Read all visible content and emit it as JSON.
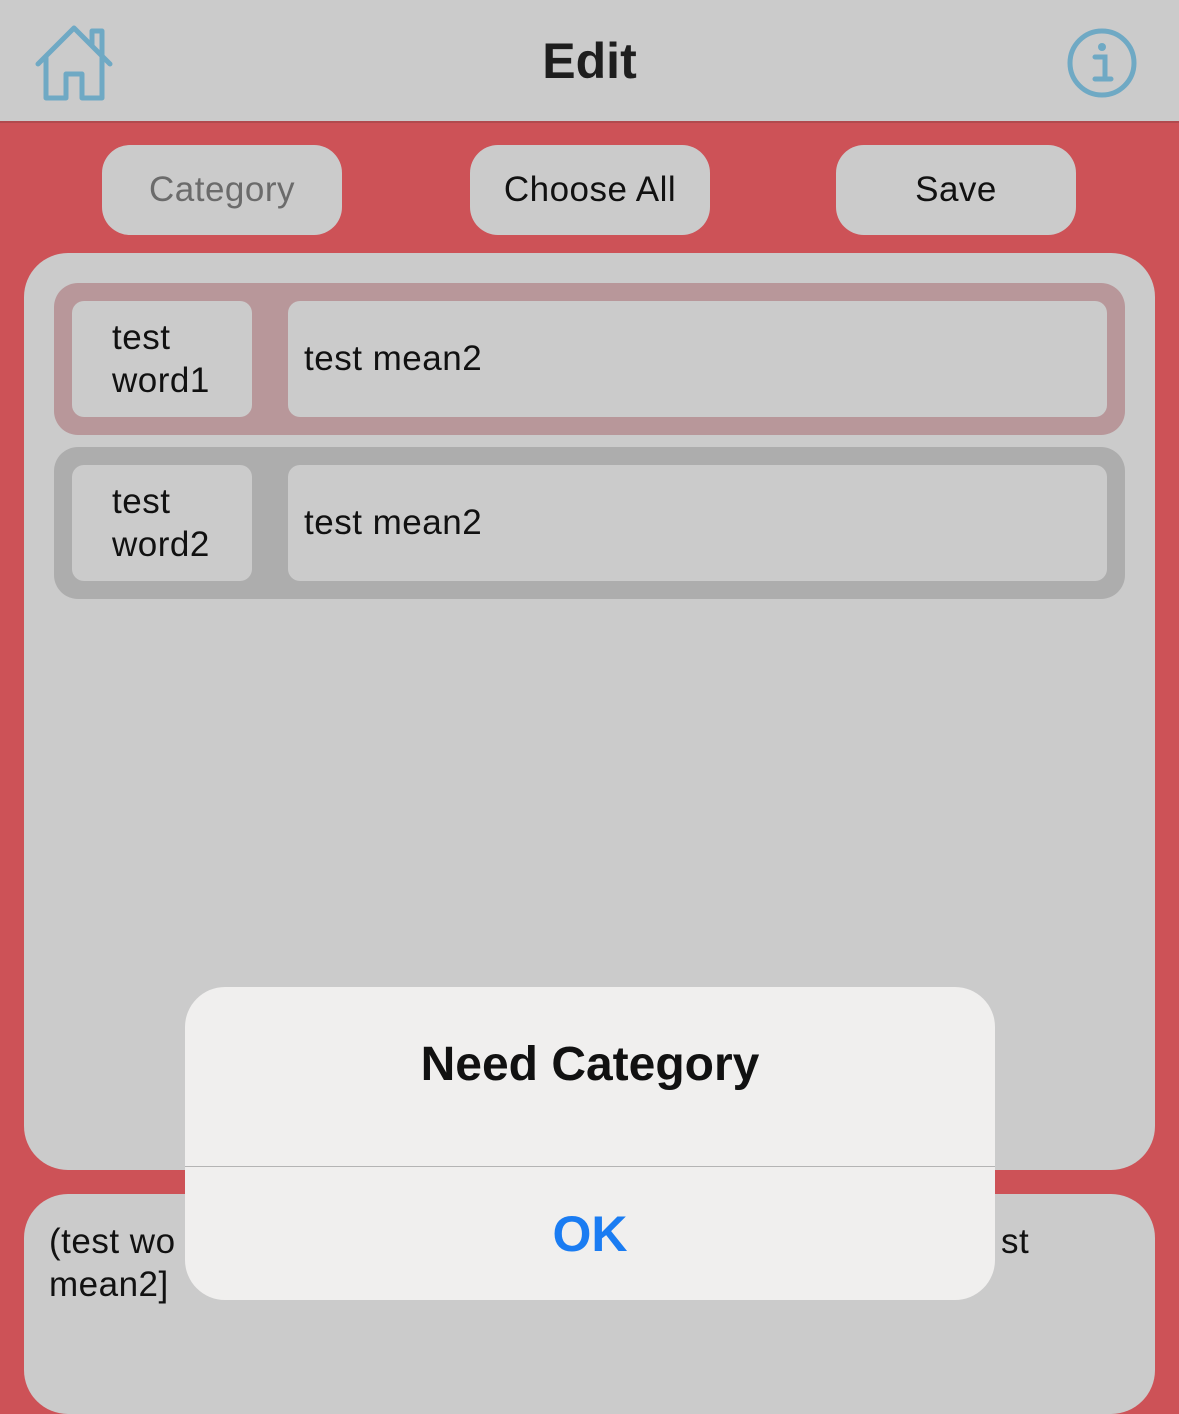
{
  "navbar": {
    "title": "Edit",
    "home_icon": "home-icon",
    "info_icon": "info-icon",
    "icon_color": "#6fa9c4"
  },
  "toolbar": {
    "category_label": "Category",
    "choose_all_label": "Choose All",
    "save_label": "Save"
  },
  "rows": [
    {
      "word": "test word1",
      "meaning": "test mean2",
      "selected": true
    },
    {
      "word": "test word2",
      "meaning": "test mean2",
      "selected": false
    }
  ],
  "preview": {
    "text": "(test word1 ... test mean2] ... test mean2]",
    "visible_left": "(test wo",
    "visible_right": "st",
    "visible_line2": "mean2]"
  },
  "alert": {
    "title": "Need Category",
    "ok_label": "OK"
  },
  "colors": {
    "background": "#cd5257",
    "panel": "#cbcbcb",
    "selected_row": "#b8979a",
    "normal_row": "#adadad",
    "alert_button": "#1a7cf2"
  }
}
